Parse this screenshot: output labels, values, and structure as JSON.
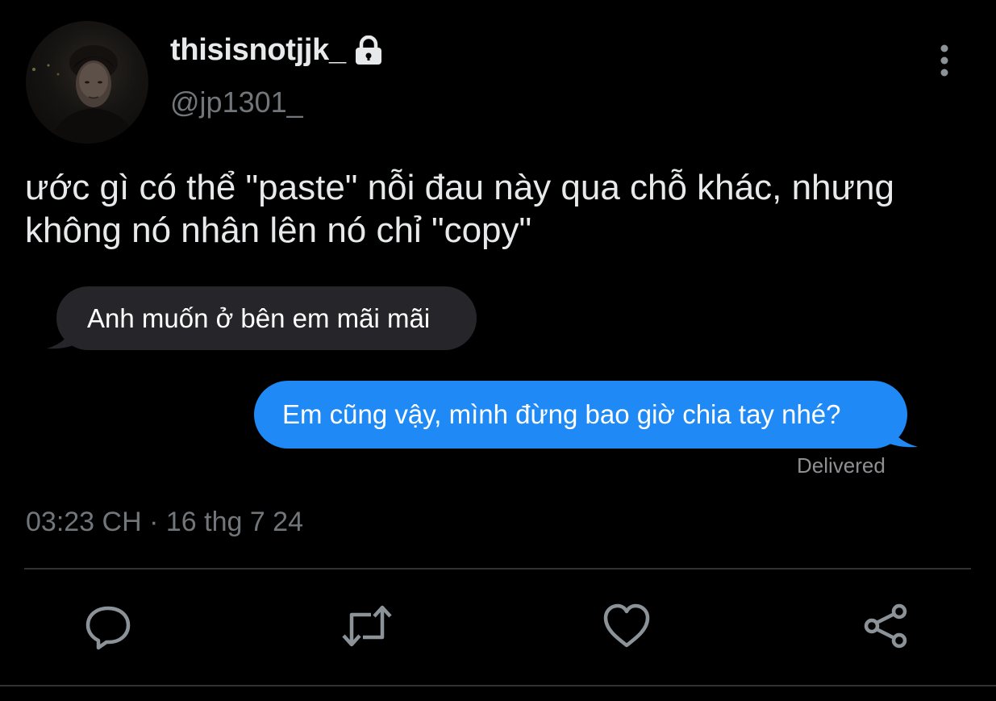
{
  "header": {
    "display_name": "thisisnotjjk_",
    "handle": "@jp1301_",
    "protected_icon": "lock-icon",
    "menu_icon": "more-vertical-icon"
  },
  "tweet": {
    "text_lines": [
      "ước gì có thể \"paste\" nỗi đau này qua chỗ khác, nhưng",
      "không nó nhân lên nó chỉ \"copy\""
    ],
    "timestamp": "03:23 CH · 16 thg 7 24"
  },
  "attached_image": {
    "messages": [
      {
        "direction": "received",
        "text": "Anh muốn ở bên em mãi mãi"
      },
      {
        "direction": "sent",
        "text": "Em cũng vậy, mình đừng bao giờ chia tay nhé?"
      }
    ],
    "status": "Delivered"
  },
  "actions": [
    {
      "name": "reply",
      "icon": "reply-icon"
    },
    {
      "name": "retweet",
      "icon": "retweet-icon"
    },
    {
      "name": "like",
      "icon": "heart-icon"
    },
    {
      "name": "share",
      "icon": "share-icon"
    }
  ],
  "colors": {
    "background": "#000000",
    "primary_text": "#e7e9ea",
    "secondary_text": "#71767b",
    "sent_bubble": "#1f8af5",
    "received_bubble": "#26252a",
    "divider": "#2f3336"
  }
}
